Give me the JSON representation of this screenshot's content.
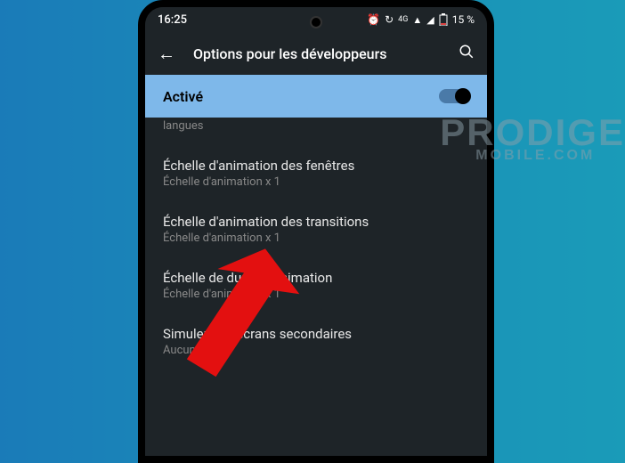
{
  "status": {
    "time": "16:25",
    "battery_text": "15 %",
    "net_label": "4G"
  },
  "header": {
    "title": "Options pour les développeurs"
  },
  "toggle": {
    "label": "Activé",
    "state": "on"
  },
  "settings": {
    "partial_top_subtitle": "langues",
    "items": [
      {
        "title": "Échelle d'animation des fenêtres",
        "subtitle": "Échelle d'animation x 1"
      },
      {
        "title": "Échelle d'animation des transitions",
        "subtitle": "Échelle d'animation x 1"
      },
      {
        "title": "Échelle de durée d'animation",
        "subtitle": "Échelle d'animation x 1"
      },
      {
        "title": "Simuler des écrans secondaires",
        "subtitle": "Aucun"
      }
    ]
  },
  "watermark": {
    "main": "PRODIGE",
    "sub": "MOBILE.COM"
  }
}
